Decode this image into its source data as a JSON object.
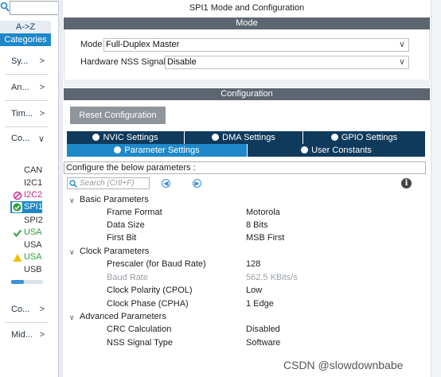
{
  "sidebar": {
    "tab_az": "A->Z",
    "tab_categories": "Categories",
    "categories": [
      {
        "label": "Sy...",
        "chev": ">"
      },
      {
        "label": "An...",
        "chev": ">"
      },
      {
        "label": "Tim...",
        "chev": ">"
      },
      {
        "label": "Co...",
        "chev": "∨"
      },
      {
        "label": "Co...",
        "chev": ">"
      },
      {
        "label": "Mid...",
        "chev": ">"
      }
    ],
    "peripherals": [
      "CAN",
      "I2C1",
      "I2C2",
      "SPI1",
      "SPI2",
      "USA",
      "USA",
      "USA",
      "USB"
    ]
  },
  "main": {
    "title": "SPI1 Mode and Configuration",
    "mode_bar": "Mode",
    "mode_label": "Mode",
    "mode_value": "Full-Duplex Master",
    "nss_label": "Hardware NSS Signal",
    "nss_value": "Disable",
    "config_bar": "Configuration",
    "reset_button": "Reset Configuration",
    "tabs": {
      "nvic": "NVIC Settings",
      "dma": "DMA Settings",
      "gpio": "GPIO Settings",
      "params": "Parameter Settings",
      "user": "User Constants"
    },
    "params_heading": "Configure the below parameters :",
    "search_placeholder": "Search (Crtl+F)",
    "groups": {
      "basic": "Basic Parameters",
      "clock": "Clock Parameters",
      "advanced": "Advanced Parameters"
    },
    "params": {
      "frame_format": {
        "name": "Frame Format",
        "value": "Motorola"
      },
      "data_size": {
        "name": "Data Size",
        "value": "8 Bits"
      },
      "first_bit": {
        "name": "First Bit",
        "value": "MSB First"
      },
      "prescaler": {
        "name": "Prescaler (for Baud Rate)",
        "value": "128"
      },
      "baud_rate": {
        "name": "Baud Rate",
        "value": "562.5 KBits/s"
      },
      "cpol": {
        "name": "Clock Polarity (CPOL)",
        "value": "Low"
      },
      "cpha": {
        "name": "Clock Phase (CPHA)",
        "value": "1 Edge"
      },
      "crc": {
        "name": "CRC Calculation",
        "value": "Disabled"
      },
      "nss_type": {
        "name": "NSS Signal Type",
        "value": "Software"
      }
    }
  },
  "watermark": "CSDN @slowdownbabe",
  "colors": {
    "accent": "#1e88c8",
    "header_bar": "#5d6670",
    "tab_dark": "#0f3a5c",
    "ok_green": "#2a9d3a",
    "error_pink": "#d0208a",
    "warn_yellow": "#f0c000"
  }
}
